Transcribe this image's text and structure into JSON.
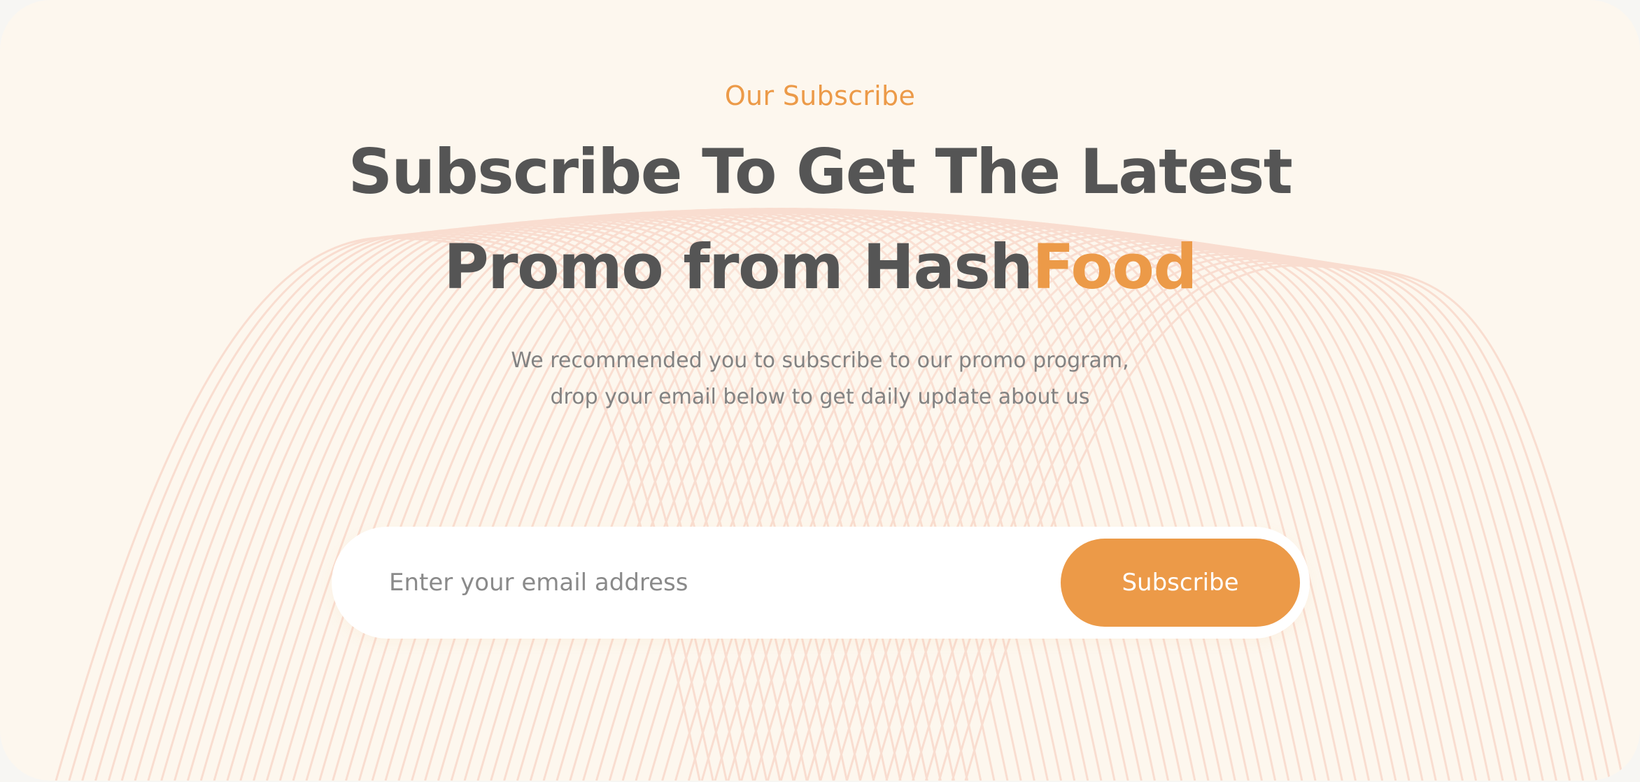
{
  "section": {
    "eyebrow": "Our Subscribe",
    "headline": {
      "line1": "Subscribe To Get The Latest",
      "line2_prefix": "Promo from Hash",
      "line2_accent": "Food"
    },
    "description": {
      "line1": "We recommended you to subscribe to our promo program,",
      "line2": "drop your email below to get daily update about us"
    }
  },
  "form": {
    "email_placeholder": "Enter your email address",
    "email_value": "",
    "button_label": "Subscribe"
  },
  "colors": {
    "accent": "#ec9a48",
    "heading": "#555555",
    "body_text": "#828282",
    "background": "#fdf7ee",
    "wave_lines": "#f6c9b8"
  }
}
